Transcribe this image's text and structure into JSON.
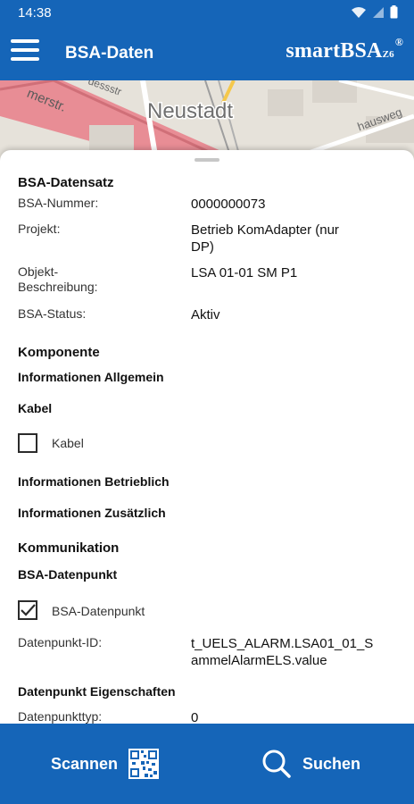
{
  "status_bar": {
    "time": "14:38"
  },
  "app_bar": {
    "title": "BSA-Daten",
    "brand_main": "smartBSA",
    "brand_sub": "Z6",
    "brand_mark": "®"
  },
  "map": {
    "labels": [
      "Neustadt",
      "merstr.",
      "dessstr",
      "hausweg"
    ]
  },
  "bsa_datensatz": {
    "title": "BSA-Datensatz",
    "fields": [
      {
        "label": "BSA-Nummer:",
        "value": "0000000073"
      },
      {
        "label": "Projekt:",
        "value": "Betrieb KomAdapter (nur DP)"
      },
      {
        "label": "Objekt-Beschreibung:",
        "value": "LSA 01-01 SM P1"
      },
      {
        "label": "BSA-Status:",
        "value": "Aktiv"
      }
    ]
  },
  "komponente": {
    "title": "Komponente",
    "info_allgemein": "Informationen Allgemein",
    "kabel_title": "Kabel",
    "kabel_checkbox": {
      "label": "Kabel",
      "checked": false
    },
    "info_betrieblich": "Informationen Betrieblich",
    "info_zusaetzlich": "Informationen Zusätzlich"
  },
  "kommunikation": {
    "title": "Kommunikation",
    "datenpunkt_title": "BSA-Datenpunkt",
    "datenpunkt_checkbox": {
      "label": "BSA-Datenpunkt",
      "checked": true
    },
    "datenpunkt_id_label": "Datenpunkt-ID:",
    "datenpunkt_id_value": "t_UELS_ALARM.LSA01_01_SammelAlarmELS.value",
    "eigenschaften_title": "Datenpunkt Eigenschaften",
    "datenpunkttyp_label": "Datenpunkttyp:",
    "datenpunkttyp_value": "0"
  },
  "bottom_bar": {
    "scan_label": "Scannen",
    "search_label": "Suchen"
  },
  "colors": {
    "primary": "#1565b8",
    "map_road": "#e88d95"
  }
}
